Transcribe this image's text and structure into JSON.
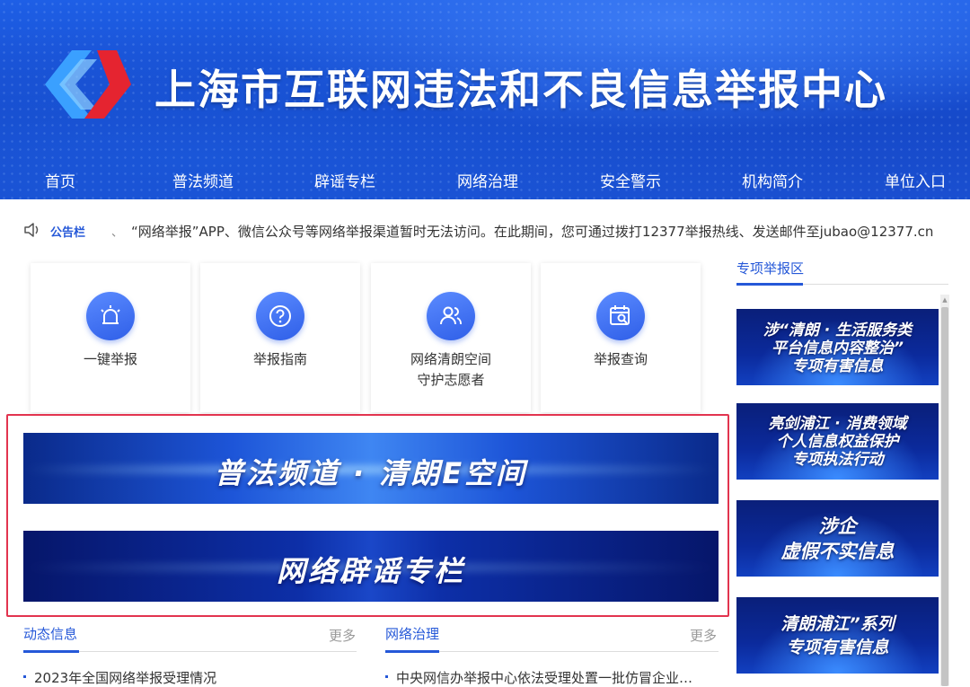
{
  "header": {
    "title": "上海市互联网违法和不良信息举报中心",
    "nav": [
      "首页",
      "普法频道",
      "辟谣专栏",
      "网络治理",
      "安全警示",
      "机构简介",
      "单位入口"
    ]
  },
  "notice": {
    "label": "公告栏",
    "separator": "、",
    "text": "“网络举报”APP、微信公众号等网络举报渠道暂时无法访问。在此期间，您可通过拨打12377举报热线、发送邮件至jubao@12377.cn"
  },
  "cards": [
    {
      "label": "一键举报",
      "icon": "alarm-icon"
    },
    {
      "label": "举报指南",
      "icon": "question-icon"
    },
    {
      "label": "网络清朗空间",
      "label2": "守护志愿者",
      "icon": "users-icon"
    },
    {
      "label": "举报查询",
      "icon": "calendar-search-icon"
    }
  ],
  "banners": [
    {
      "text": "普法频道 · 清朗E空间"
    },
    {
      "text": "网络辟谣专栏"
    }
  ],
  "sidebar": {
    "title": "专项举报区",
    "banners": [
      {
        "lines": [
          "涉“清朗 · 生活服务类",
          "平台信息内容整治”",
          "专项有害信息"
        ]
      },
      {
        "lines": [
          "亮剑浦江 · 消费领域",
          "个人信息权益保护",
          "专项执法行动"
        ]
      },
      {
        "lines": [
          "涉企",
          "虚假不实信息"
        ]
      },
      {
        "lines": [
          "清朗浦江”系列",
          "专项有害信息"
        ]
      }
    ]
  },
  "sections": [
    {
      "title": "动态信息",
      "more": "更多",
      "items": [
        "2023年全国网络举报受理情况"
      ]
    },
    {
      "title": "网络治理",
      "more": "更多",
      "items": [
        "中央网信办举报中心依法受理处置一批仿冒企业…"
      ]
    }
  ],
  "colors": {
    "accent": "#2558d8",
    "highlight_border": "#e2344f",
    "header_blue": "#1a4fd0"
  }
}
